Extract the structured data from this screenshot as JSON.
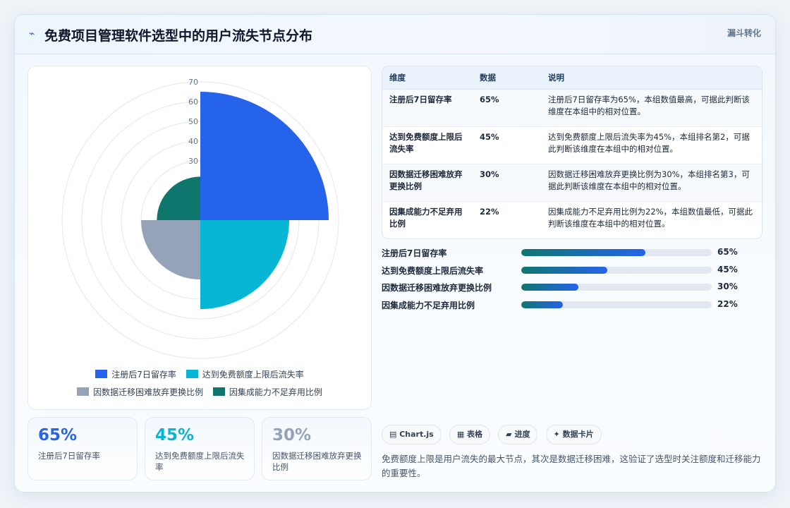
{
  "header": {
    "icon": "⌁",
    "title": "免费项目管理软件选型中的用户流失节点分布",
    "tag": "漏斗转化"
  },
  "chart_data": {
    "type": "polarArea",
    "categories": [
      "注册后7日留存率",
      "达到免费额度上限后流失率",
      "因数据迁移困难放弃更换比例",
      "因集成能力不足弃用比例"
    ],
    "values": [
      65,
      45,
      30,
      22
    ],
    "colors": [
      "#2563eb",
      "#06b6d4",
      "#94a3b8",
      "#0f766e"
    ],
    "rlim": [
      0,
      70
    ],
    "r_ticks": [
      "30",
      "40",
      "50",
      "60",
      "70"
    ],
    "legend_position": "bottom"
  },
  "table": {
    "headers": [
      "维度",
      "数据",
      "说明"
    ],
    "rows": [
      {
        "name": "注册后7日留存率",
        "value": "65%",
        "desc": "注册后7日留存率为65%，本组数值最高，可据此判断该维度在本组中的相对位置。"
      },
      {
        "name": "达到免费额度上限后流失率",
        "value": "45%",
        "desc": "达到免费额度上限后流失率为45%，本组排名第2，可据此判断该维度在本组中的相对位置。"
      },
      {
        "name": "因数据迁移困难放弃更换比例",
        "value": "30%",
        "desc": "因数据迁移困难放弃更换比例为30%，本组排名第3，可据此判断该维度在本组中的相对位置。"
      },
      {
        "name": "因集成能力不足弃用比例",
        "value": "22%",
        "desc": "因集成能力不足弃用比例为22%，本组数值最低，可据此判断该维度在本组中的相对位置。"
      }
    ]
  },
  "progress": [
    {
      "label": "注册后7日留存率",
      "value": 65,
      "text": "65%"
    },
    {
      "label": "达到免费额度上限后流失率",
      "value": 45,
      "text": "45%"
    },
    {
      "label": "因数据迁移困难放弃更换比例",
      "value": 30,
      "text": "30%"
    },
    {
      "label": "因集成能力不足弃用比例",
      "value": 22,
      "text": "22%"
    }
  ],
  "kpis": [
    {
      "value": "65%",
      "label": "注册后7日留存率",
      "color": "#2563eb"
    },
    {
      "value": "45%",
      "label": "达到免费额度上限后流失率",
      "color": "#06b6d4"
    },
    {
      "value": "30%",
      "label": "因数据迁移困难放弃更换比例",
      "color": "#94a3b8"
    }
  ],
  "chips": [
    "▤ Chart.js",
    "▦ 表格",
    "▰ 进度",
    "✦ 数据卡片"
  ],
  "summary": "免费额度上限是用户流失的最大节点，其次是数据迁移困难，这验证了选型时关注额度和迁移能力的重要性。"
}
